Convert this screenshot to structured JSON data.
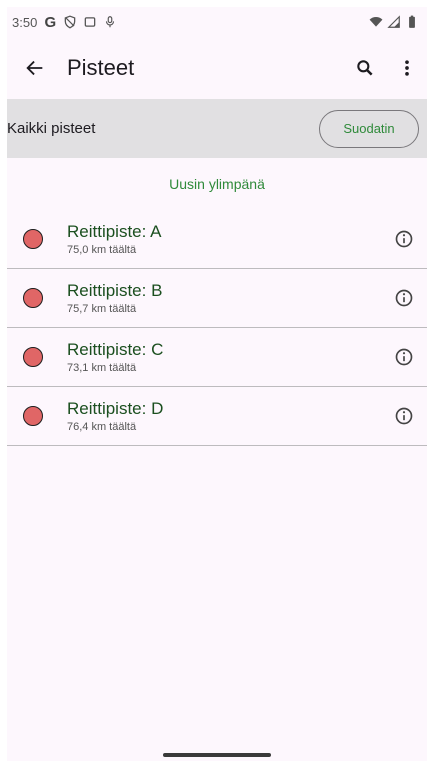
{
  "status_bar": {
    "time": "3:50",
    "icons_left": [
      "google-g-icon",
      "shield-icon",
      "screen-icon",
      "mic-icon"
    ],
    "icons_right": [
      "wifi-icon",
      "signal-icon",
      "battery-icon"
    ]
  },
  "app_bar": {
    "title": "Pisteet"
  },
  "filter": {
    "label": "Kaikki pisteet",
    "button": "Suodatin"
  },
  "sort_label": "Uusin ylimpänä",
  "points": [
    {
      "name": "Reittipiste: A",
      "distance": "75,0 km täältä",
      "color": "#e06666"
    },
    {
      "name": "Reittipiste: B",
      "distance": "75,7 km täältä",
      "color": "#e06666"
    },
    {
      "name": "Reittipiste: C",
      "distance": "73,1 km täältä",
      "color": "#e06666"
    },
    {
      "name": "Reittipiste: D",
      "distance": "76,4 km täältä",
      "color": "#e06666"
    }
  ],
  "colors": {
    "accent_green": "#2f8a3a",
    "title_green": "#1b4f1f",
    "background": "#fdf7fd",
    "filter_bar": "#e1e0e2"
  }
}
